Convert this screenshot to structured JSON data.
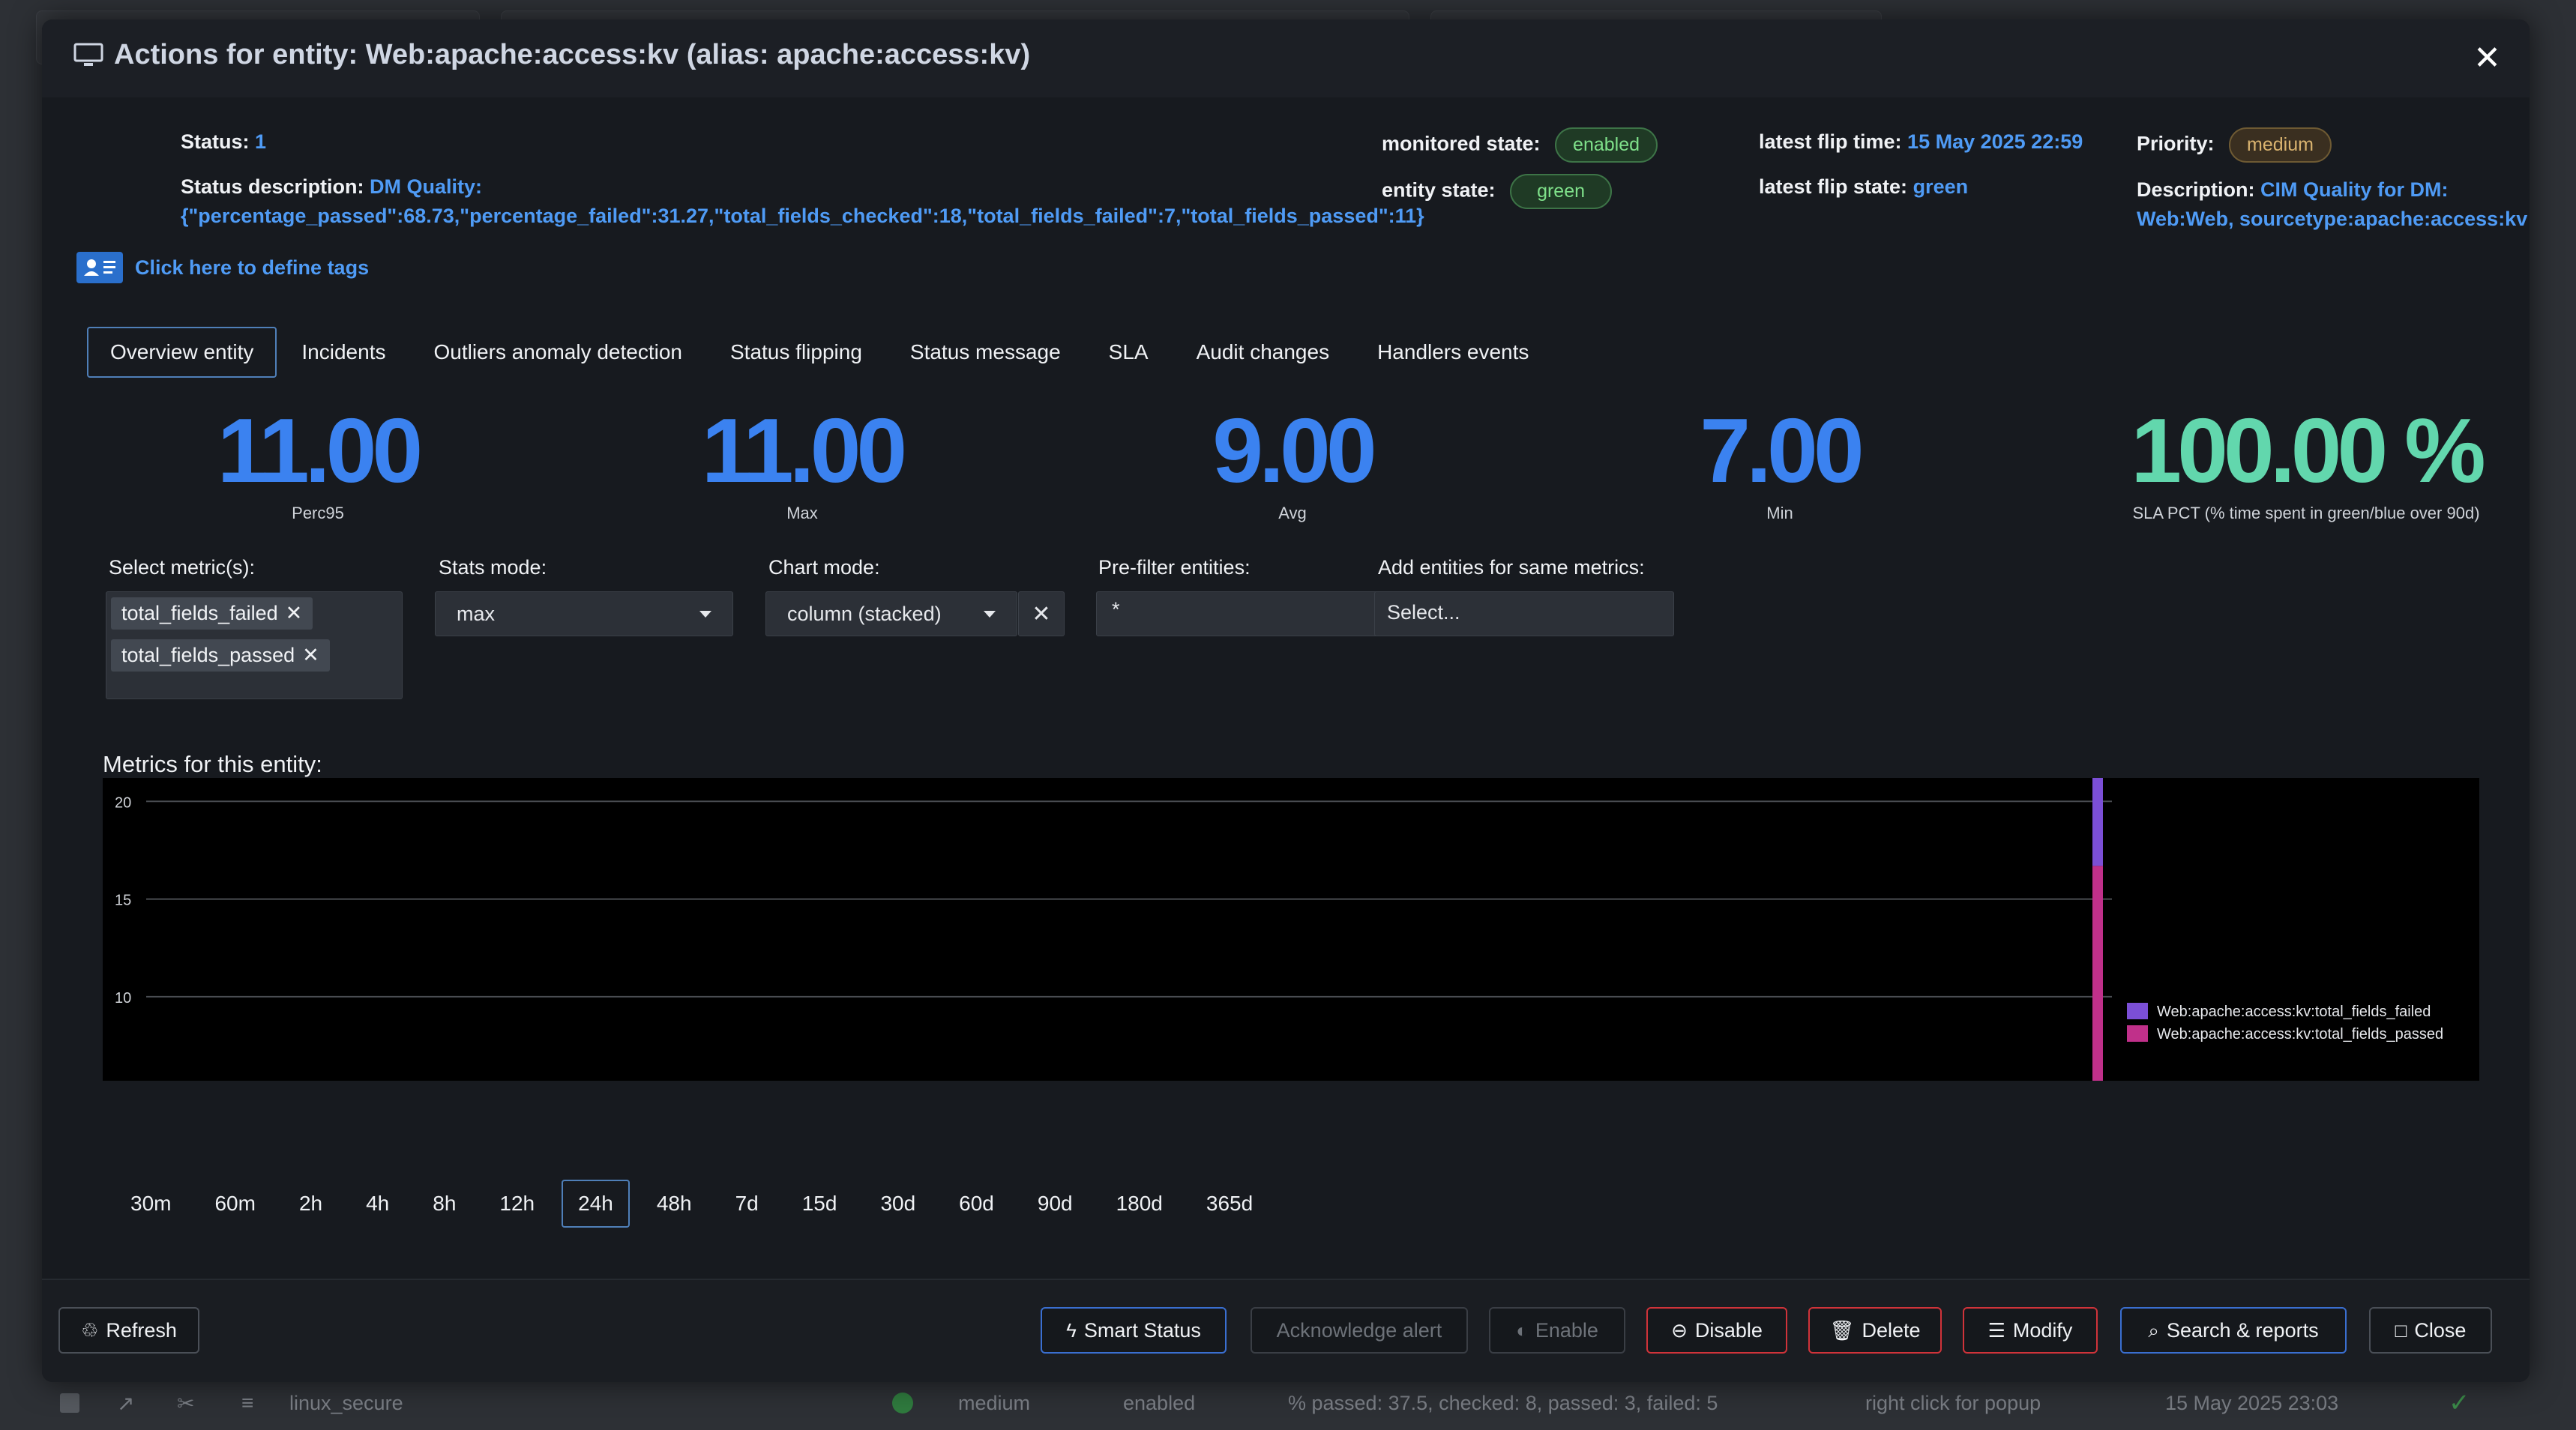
{
  "background": {
    "row": {
      "name": "linux_secure",
      "priority": "medium",
      "state": "enabled",
      "status_desc": "% passed: 37.5, checked: 8, passed: 3, failed: 5",
      "hint": "right click for popup",
      "time": "15 May 2025 23:03",
      "check_icon": "✓"
    }
  },
  "modal": {
    "title": "Actions for entity: Web:apache:access:kv (alias: apache:access:kv)",
    "close_glyph": "✕"
  },
  "info": {
    "status_label": "Status:",
    "status_value": "1",
    "status_desc_label": "Status description:",
    "status_desc_value_1": "DM Quality:",
    "status_desc_value_2": "{\"percentage_passed\":68.73,\"percentage_failed\":31.27,\"total_fields_checked\":18,\"total_fields_failed\":7,\"total_fields_passed\":11}",
    "monitored_state_label": "monitored state:",
    "monitored_state_value": "enabled",
    "entity_state_label": "entity state:",
    "entity_state_value": "green",
    "flip_time_label": "latest flip time:",
    "flip_time_value": "15 May 2025 22:59",
    "flip_state_label": "latest flip state:",
    "flip_state_value": "green",
    "priority_label": "Priority:",
    "priority_value": "medium",
    "description_label": "Description:",
    "description_value_1": "CIM Quality for DM:",
    "description_value_2": "Web:Web, sourcetype:apache:access:kv",
    "tags_link": "Click here to define tags"
  },
  "tabs": [
    "Overview entity",
    "Incidents",
    "Outliers anomaly detection",
    "Status flipping",
    "Status message",
    "SLA",
    "Audit changes",
    "Handlers events"
  ],
  "kpis": [
    {
      "value": "11.00",
      "label": "Perc95"
    },
    {
      "value": "11.00",
      "label": "Max"
    },
    {
      "value": "9.00",
      "label": "Avg"
    },
    {
      "value": "7.00",
      "label": "Min"
    },
    {
      "value": "100.00 %",
      "label": "SLA PCT (% time spent in green/blue over 90d)"
    }
  ],
  "controls": {
    "metrics_label": "Select metric(s):",
    "metrics_chips": [
      "total_fields_failed",
      "total_fields_passed"
    ],
    "stats_label": "Stats mode:",
    "stats_value": "max",
    "chart_mode_label": "Chart mode:",
    "chart_mode_value": "column (stacked)",
    "prefilter_label": "Pre-filter entities:",
    "prefilter_value": "*",
    "add_label": "Add entities for same metrics:",
    "add_placeholder": "Select..."
  },
  "metrics_title": "Metrics for this entity:",
  "chart_data": {
    "type": "bar",
    "stacked": true,
    "y_ticks": [
      "20",
      "15",
      "10"
    ],
    "ylim": [
      5.7,
      21.2
    ],
    "grid": true,
    "legend_position": "bottom-right",
    "series": [
      {
        "name": "Web:apache:access:kv:total_fields_failed",
        "color": "#7b4fd6",
        "values": [
          7
        ]
      },
      {
        "name": "Web:apache:access:kv:total_fields_passed",
        "color": "#c0308a",
        "values": [
          11
        ]
      }
    ]
  },
  "ranges": [
    "30m",
    "60m",
    "2h",
    "4h",
    "8h",
    "12h",
    "24h",
    "48h",
    "7d",
    "15d",
    "30d",
    "60d",
    "90d",
    "180d",
    "365d"
  ],
  "active_range": "24h",
  "buttons": {
    "refresh": "Refresh",
    "smart_status": "Smart Status",
    "acknowledge": "Acknowledge alert",
    "enable": "Enable",
    "disable": "Disable",
    "delete": "Delete",
    "modify": "Modify",
    "search": "Search & reports",
    "close": "Close"
  }
}
